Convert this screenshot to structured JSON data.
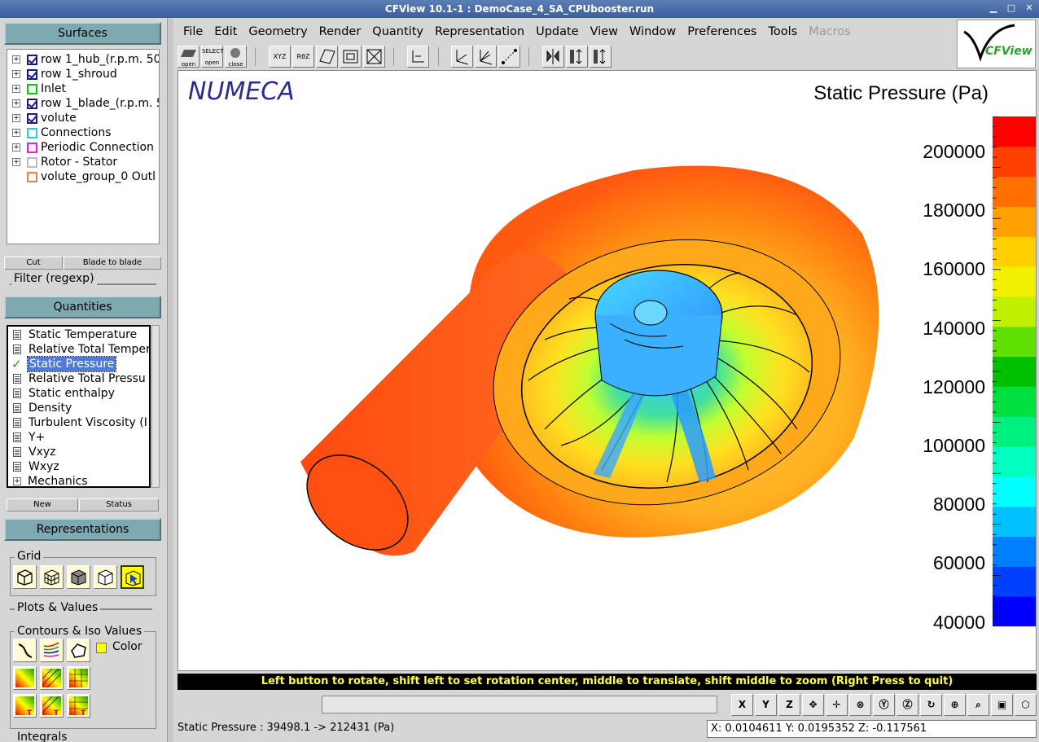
{
  "window": {
    "title": "CFView 10.1-1 : DemoCase_4_SA_CPUbooster.run"
  },
  "surfaces": {
    "header": "Surfaces",
    "items": [
      {
        "label": "row 1_hub_(r.p.m. 50",
        "checked": true,
        "color": "#1a1a8a",
        "expandable": true
      },
      {
        "label": "row 1_shroud",
        "checked": true,
        "color": "#1a1a8a",
        "expandable": true
      },
      {
        "label": "Inlet",
        "checked": false,
        "color": "#00d000",
        "expandable": true
      },
      {
        "label": "row 1_blade_(r.p.m. 5",
        "checked": true,
        "color": "#1a1a8a",
        "expandable": true
      },
      {
        "label": "volute",
        "checked": true,
        "color": "#1a1a8a",
        "expandable": true
      },
      {
        "label": "Connections",
        "checked": false,
        "color": "#20d0e0",
        "expandable": true
      },
      {
        "label": "Periodic Connection",
        "checked": false,
        "color": "#e020e0",
        "expandable": true
      },
      {
        "label": "Rotor - Stator",
        "checked": false,
        "color": "#bbbbbb",
        "expandable": true
      },
      {
        "label": "volute_group_0 Outl",
        "checked": false,
        "color": "#f08040",
        "expandable": false
      }
    ],
    "cut_label": "Cut",
    "blade_label": "Blade to blade",
    "filter_label": "Filter (regexp)"
  },
  "quantities": {
    "header": "Quantities",
    "items": [
      {
        "label": "Static Temperature",
        "selected": false
      },
      {
        "label": "Relative Total Temper",
        "selected": false
      },
      {
        "label": "Static Pressure",
        "selected": true
      },
      {
        "label": "Relative Total Pressu",
        "selected": false
      },
      {
        "label": "Static enthalpy",
        "selected": false
      },
      {
        "label": "Density",
        "selected": false
      },
      {
        "label": "Turbulent Viscosity (I",
        "selected": false
      },
      {
        "label": "Y+",
        "selected": false
      },
      {
        "label": "Vxyz",
        "selected": false
      },
      {
        "label": "Wxyz",
        "selected": false
      },
      {
        "label": "Mechanics",
        "selected": false,
        "expandable": true
      }
    ],
    "new_label": "New",
    "status_label": "Status"
  },
  "representations": {
    "header": "Representations",
    "grid_label": "Grid",
    "plots_label": "Plots & Values",
    "contours_label": "Contours & Iso Values",
    "color_label": "Color",
    "integrals_label": "Integrals"
  },
  "menu": [
    "File",
    "Edit",
    "Geometry",
    "Render",
    "Quantity",
    "Representation",
    "Update",
    "View",
    "Window",
    "Preferences",
    "Tools"
  ],
  "menu_disabled": "Macros",
  "toolbar": {
    "open1": "open",
    "select": "SELECT",
    "open2": "open",
    "close": "close",
    "xyz": "XYZ",
    "rqz": "RθZ"
  },
  "logo_text": "CFView",
  "viewport": {
    "brand": "NUMECA",
    "quantity_title": "Static Pressure (Pa)",
    "colorbar_labels": [
      "200000",
      "180000",
      "160000",
      "140000",
      "120000",
      "100000",
      "80000",
      "60000",
      "40000"
    ],
    "colorbar_colors": [
      "#0000ff",
      "#0040ff",
      "#0080ff",
      "#00c0ff",
      "#00ffff",
      "#00ffc0",
      "#00f080",
      "#00e040",
      "#00c000",
      "#60e000",
      "#c0f000",
      "#f0f000",
      "#ffd000",
      "#ffa000",
      "#ff7000",
      "#ff4000",
      "#ff0000"
    ]
  },
  "hint": "Left button to rotate, shift left to set rotation center, middle to translate, shift middle to zoom (Right Press to quit)",
  "nav": [
    "X",
    "Y",
    "Z"
  ],
  "status": {
    "range": "Static Pressure :  39498.1  ->  212431  (Pa)",
    "coords": "X: 0.0104611   Y: 0.0195352   Z: -0.117561"
  }
}
